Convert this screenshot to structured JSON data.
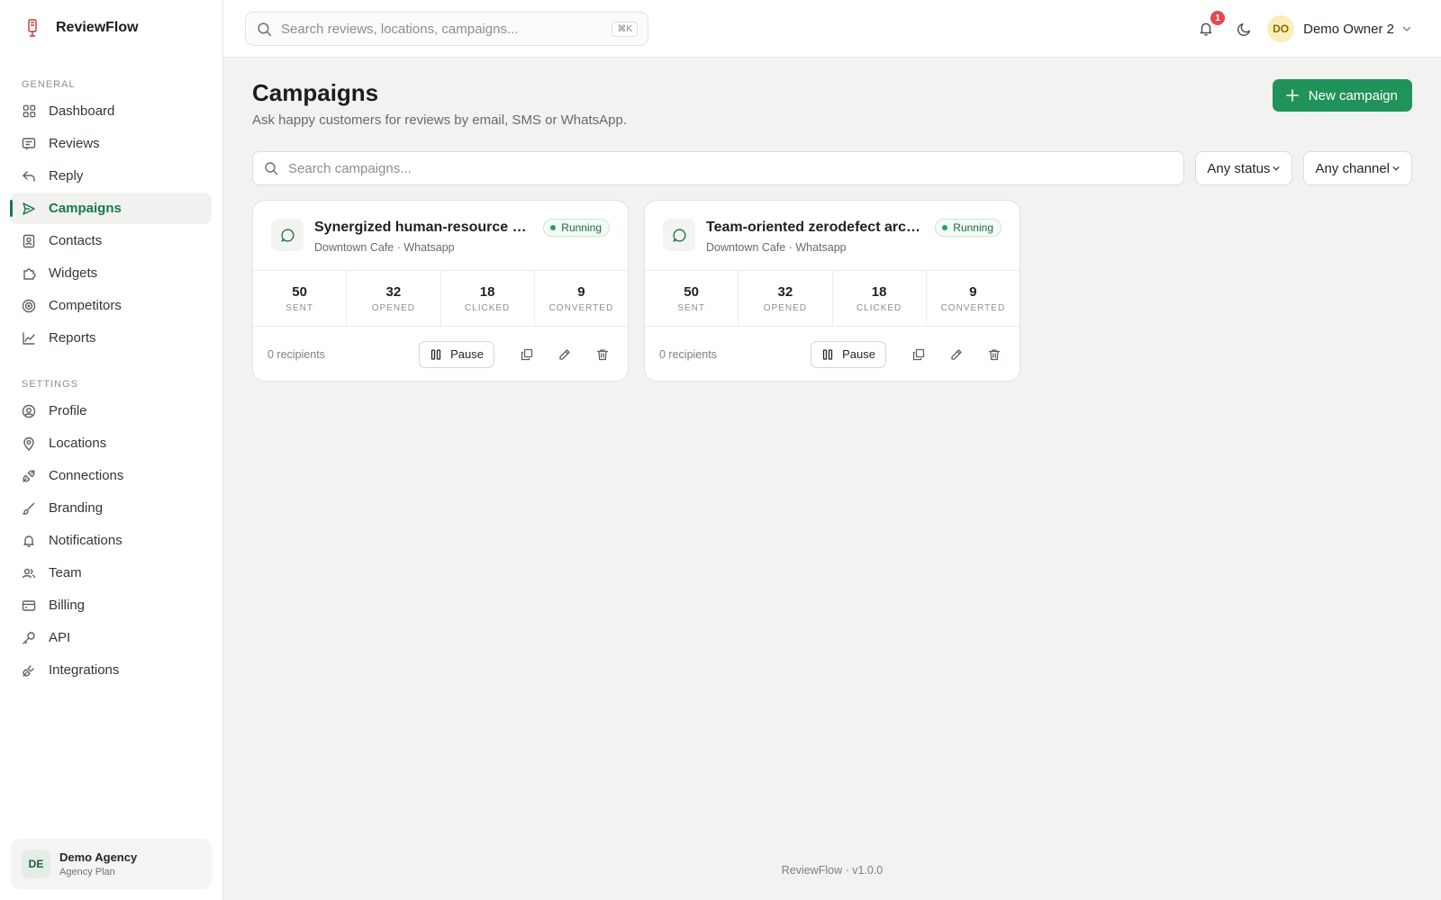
{
  "brand": {
    "name": "ReviewFlow"
  },
  "sidebar": {
    "general_label": "GENERAL",
    "general_items": [
      {
        "label": "Dashboard",
        "icon": "grid-icon"
      },
      {
        "label": "Reviews",
        "icon": "message-square-icon"
      },
      {
        "label": "Reply",
        "icon": "reply-icon"
      },
      {
        "label": "Campaigns",
        "icon": "send-icon",
        "active": true
      },
      {
        "label": "Contacts",
        "icon": "contacts-icon"
      },
      {
        "label": "Widgets",
        "icon": "puzzle-icon"
      },
      {
        "label": "Competitors",
        "icon": "target-icon"
      },
      {
        "label": "Reports",
        "icon": "chart-line-icon"
      }
    ],
    "settings_label": "SETTINGS",
    "settings_items": [
      {
        "label": "Profile",
        "icon": "user-circle-icon"
      },
      {
        "label": "Locations",
        "icon": "map-pin-icon"
      },
      {
        "label": "Connections",
        "icon": "plug-icon"
      },
      {
        "label": "Branding",
        "icon": "brush-icon"
      },
      {
        "label": "Notifications",
        "icon": "bell-icon"
      },
      {
        "label": "Team",
        "icon": "users-icon"
      },
      {
        "label": "Billing",
        "icon": "credit-card-icon"
      },
      {
        "label": "API",
        "icon": "key-icon"
      },
      {
        "label": "Integrations",
        "icon": "plug-zap-icon"
      }
    ],
    "agency": {
      "avatar": "DE",
      "name": "Demo Agency",
      "plan": "Agency Plan"
    }
  },
  "topbar": {
    "search_placeholder": "Search reviews, locations, campaigns...",
    "shortcut": "⌘K",
    "notification_count": "1",
    "user": {
      "initials": "DO",
      "name": "Demo Owner 2"
    }
  },
  "main": {
    "title": "Campaigns",
    "subtitle": "Ask happy customers for reviews by email, SMS or WhatsApp.",
    "new_button": "New campaign",
    "search_placeholder": "Search campaigns...",
    "status_filter": "Any status",
    "channel_filter": "Any channel"
  },
  "campaigns": [
    {
      "title": "Synergized human-resource ut...",
      "meta": "Downtown Cafe · Whatsapp",
      "status": "Running",
      "stats": [
        {
          "value": "50",
          "label": "SENT"
        },
        {
          "value": "32",
          "label": "OPENED"
        },
        {
          "value": "18",
          "label": "CLICKED"
        },
        {
          "value": "9",
          "label": "CONVERTED"
        }
      ],
      "recipients": "0 recipients",
      "pause_label": "Pause"
    },
    {
      "title": "Team-oriented zerodefect arch...",
      "meta": "Downtown Cafe · Whatsapp",
      "status": "Running",
      "stats": [
        {
          "value": "50",
          "label": "SENT"
        },
        {
          "value": "32",
          "label": "OPENED"
        },
        {
          "value": "18",
          "label": "CLICKED"
        },
        {
          "value": "9",
          "label": "CONVERTED"
        }
      ],
      "recipients": "0 recipients",
      "pause_label": "Pause"
    }
  ],
  "footer": {
    "text": "ReviewFlow · v1.0.0"
  },
  "colors": {
    "accent": "#20935a",
    "active_text": "#18794e",
    "badge": "#e5484d"
  }
}
